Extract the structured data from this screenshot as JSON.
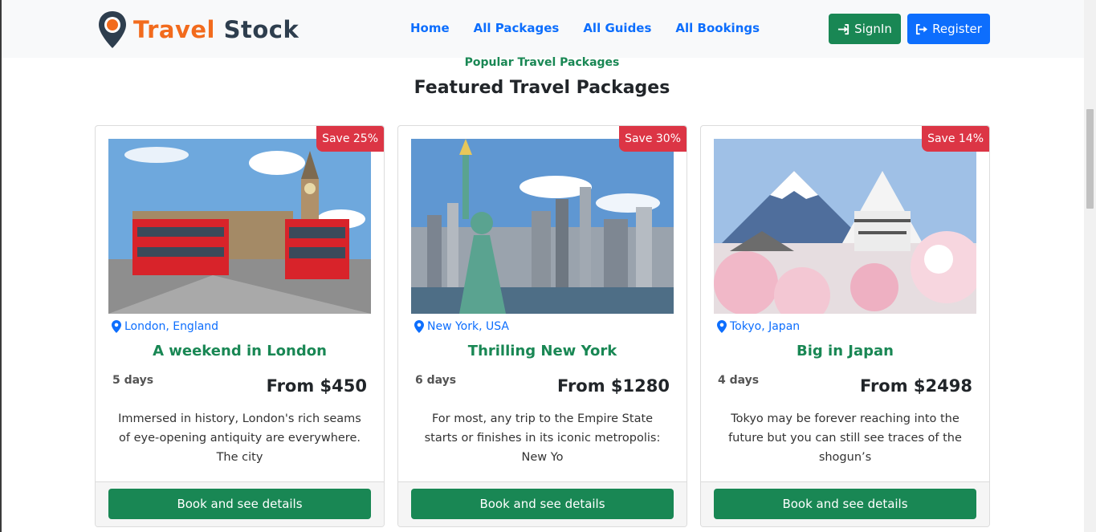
{
  "brand": {
    "word1": "Travel",
    "word2": "Stock"
  },
  "nav": {
    "home": "Home",
    "packages": "All Packages",
    "guides": "All Guides",
    "bookings": "All Bookings"
  },
  "auth": {
    "signin": "SignIn",
    "register": "Register"
  },
  "section": {
    "kicker": "Popular Travel Packages",
    "title": "Featured Travel Packages"
  },
  "packages": [
    {
      "badge": "Save 25%",
      "location": "London, England",
      "title": "A weekend in London",
      "duration": "5 days",
      "price": "From $450",
      "description": "Immersed in history, London's rich seams of eye-opening antiquity are everywhere. The city",
      "button": "Book and see details"
    },
    {
      "badge": "Save 30%",
      "location": "New York, USA",
      "title": "Thrilling New York",
      "duration": "6 days",
      "price": "From $1280",
      "description": "For most, any trip to the Empire State starts or finishes in its iconic metropolis: New Yo",
      "button": "Book and see details"
    },
    {
      "badge": "Save 14%",
      "location": "Tokyo, Japan",
      "title": "Big in Japan",
      "duration": "4 days",
      "price": "From $2498",
      "description": "Tokyo may be forever reaching into the future but you can still see traces of the shogun’s",
      "button": "Book and see details"
    }
  ],
  "colors": {
    "primary": "#0d6efd",
    "success": "#198754",
    "danger": "#dc3545",
    "brand_orange": "#f26b1d"
  }
}
